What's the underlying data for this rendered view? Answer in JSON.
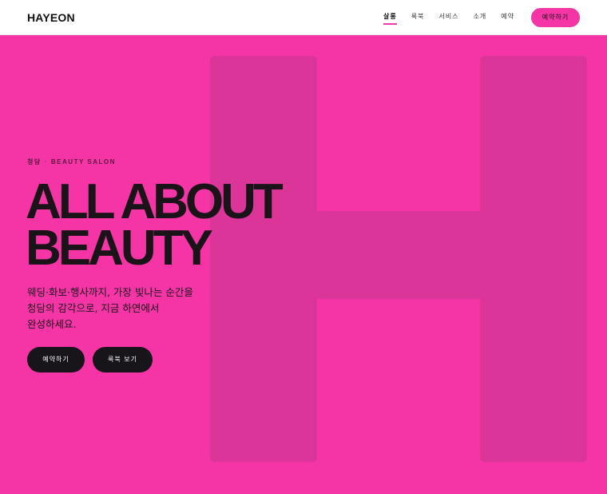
{
  "header": {
    "logo": "HAYEON",
    "nav": [
      {
        "label": "살롱",
        "active": true
      },
      {
        "label": "룩북",
        "active": false
      },
      {
        "label": "서비스",
        "active": false
      },
      {
        "label": "소개",
        "active": false
      },
      {
        "label": "예약",
        "active": false
      }
    ],
    "cta_label": "예약하기"
  },
  "hero": {
    "eyebrow_primary": "청담",
    "eyebrow_separator": "·",
    "eyebrow_secondary": "BEAUTY SALON",
    "headline_line1": "ALL ABOUT",
    "headline_line2": "BEAUTY",
    "subtitle_line1": "웨딩·화보·행사까지, 가장 빛나는 순간을",
    "subtitle_line2": "청담의 감각으로, 지금 하연에서",
    "subtitle_line3": "완성하세요.",
    "primary_button": "예약하기",
    "secondary_button": "룩북 보기",
    "watermark_letter": "H"
  },
  "colors": {
    "background": "#f535a6",
    "watermark": "#db3599",
    "dark": "#17141a",
    "header_bg": "#ffffff"
  }
}
